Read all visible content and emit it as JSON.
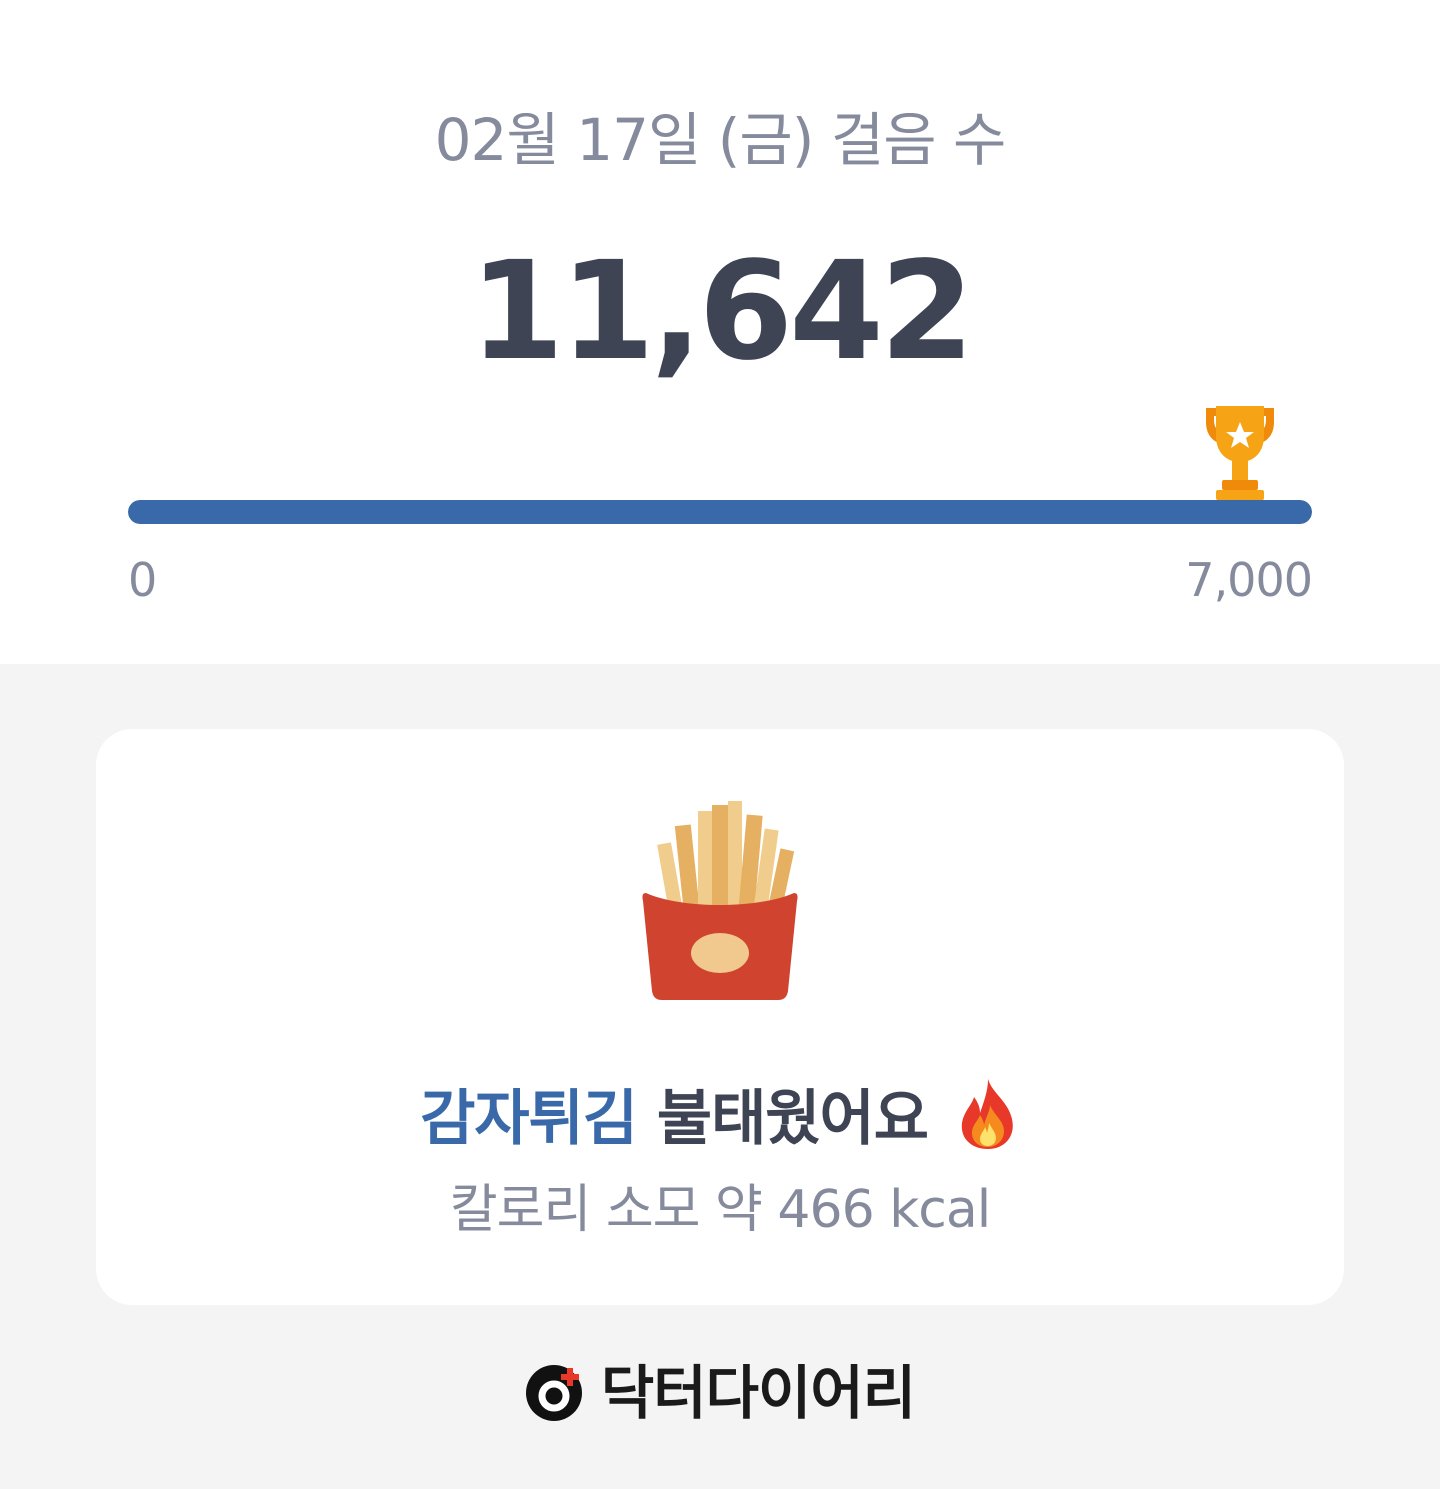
{
  "summary": {
    "date_title": "02월 17일 (금) 걸음 수",
    "steps": "11,642",
    "goal": {
      "min_label": "0",
      "max_label": "7,000",
      "progress_fraction": 1.0,
      "goal_icon": "trophy-icon"
    }
  },
  "burn_card": {
    "food_icon": "french-fries-icon",
    "food_name": "감자튀김",
    "burned_text": "불태웠어요",
    "fire_icon": "fire-icon",
    "calorie_text": "칼로리 소모 약 466 kcal"
  },
  "brand": {
    "logo_icon": "doctor-diary-logo-icon",
    "name": "닥터다이어리"
  },
  "colors": {
    "accent": "#3a69aa",
    "text_dark": "#3e4454",
    "text_muted": "#858b9c",
    "trophy": "#f6a315",
    "fries_box": "#d0432e",
    "background": "#f4f4f4"
  }
}
